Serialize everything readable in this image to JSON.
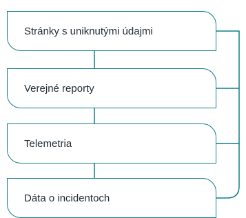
{
  "colors": {
    "stroke": "#0f7f86",
    "text": "#1f2a33",
    "background": "#ffffff"
  },
  "items": [
    {
      "label": "Stránky s uniknutými údajmi"
    },
    {
      "label": "Verejné reporty"
    },
    {
      "label": "Telemetria"
    },
    {
      "label": "Dáta o incidentoch"
    }
  ]
}
